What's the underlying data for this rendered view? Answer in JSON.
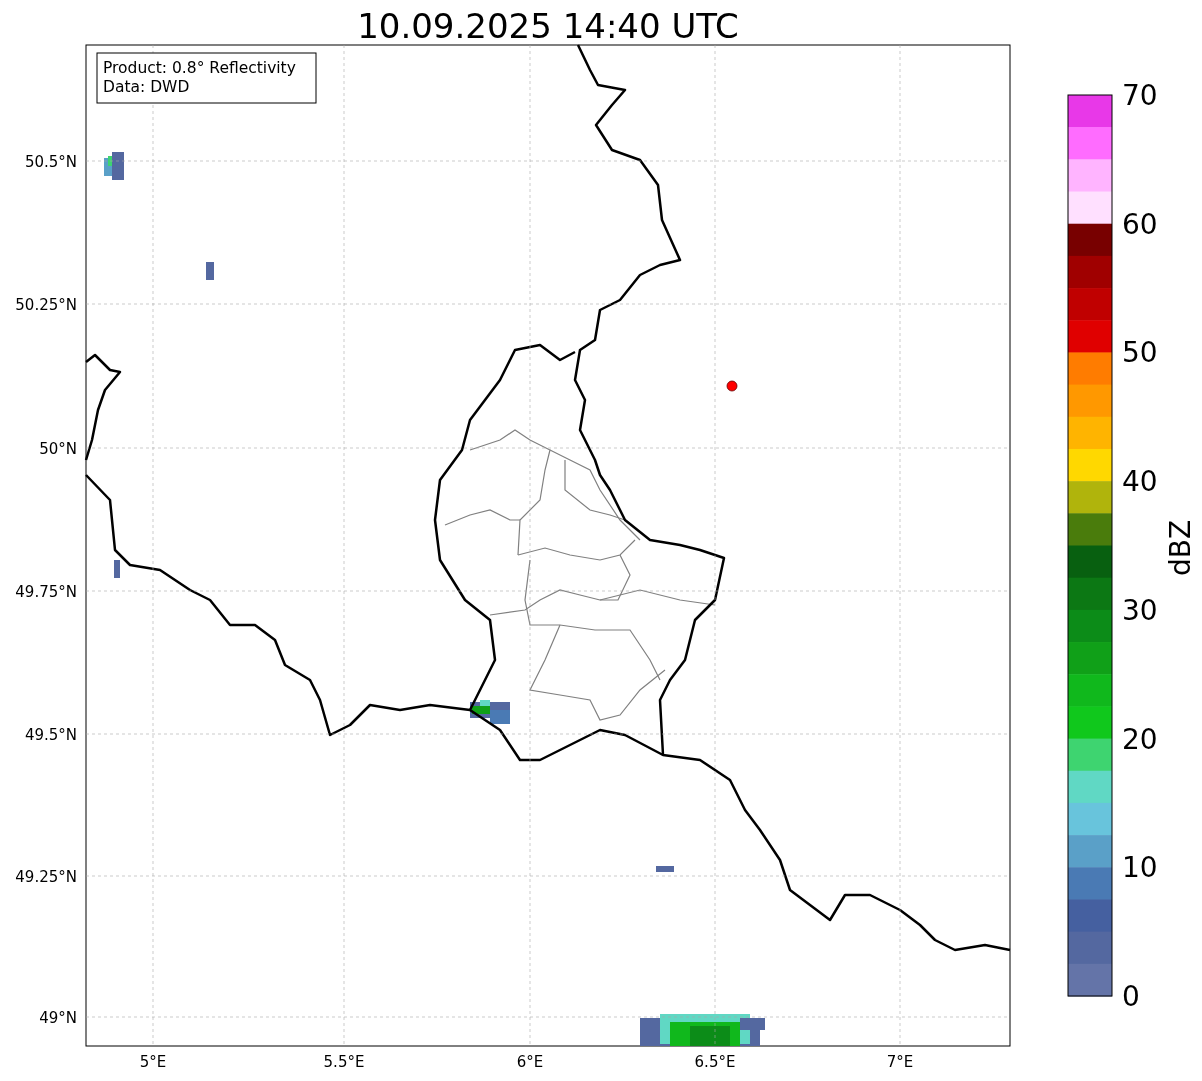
{
  "title": "10.09.2025 14:40 UTC",
  "legend": [
    "Product: 0.8° Reflectivity",
    "Data: DWD"
  ],
  "lat_ticks": [
    "50.5°N",
    "50.25°N",
    "50°N",
    "49.75°N",
    "49.5°N",
    "49.25°N",
    "49°N"
  ],
  "lon_ticks": [
    "5°E",
    "5.5°E",
    "6°E",
    "6.5°E",
    "7°E"
  ],
  "colorbar": {
    "label": "dBZ",
    "ticks": [
      "70",
      "60",
      "50",
      "40",
      "30",
      "20",
      "10",
      "0"
    ],
    "bins": [
      {
        "color": "#e838e8"
      },
      {
        "color": "#ff6cff"
      },
      {
        "color": "#ffb4ff"
      },
      {
        "color": "#ffe0ff"
      },
      {
        "color": "#780000"
      },
      {
        "color": "#a00000"
      },
      {
        "color": "#c00000"
      },
      {
        "color": "#e00000"
      },
      {
        "color": "#ff7c00"
      },
      {
        "color": "#ff9800"
      },
      {
        "color": "#ffb400"
      },
      {
        "color": "#ffd800"
      },
      {
        "color": "#b0b40c"
      },
      {
        "color": "#4a7c0c"
      },
      {
        "color": "#086010"
      },
      {
        "color": "#0c7814"
      },
      {
        "color": "#0c8c18"
      },
      {
        "color": "#10a018"
      },
      {
        "color": "#10b81c"
      },
      {
        "color": "#10c81c"
      },
      {
        "color": "#3ed470"
      },
      {
        "color": "#60d8c4"
      },
      {
        "color": "#68c4dc"
      },
      {
        "color": "#5aa0c8"
      },
      {
        "color": "#4a7ab4"
      },
      {
        "color": "#4560a0"
      },
      {
        "color": "#5468a0"
      },
      {
        "color": "#6474a8"
      }
    ]
  }
}
